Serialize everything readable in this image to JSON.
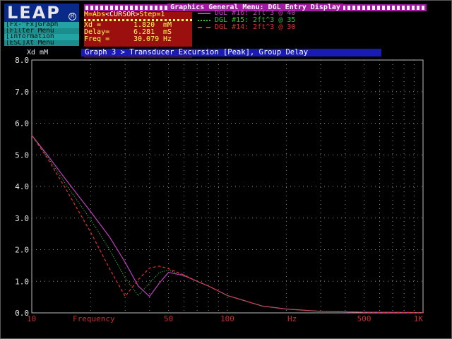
{
  "logo": {
    "text": "LEAP",
    "reg": "R"
  },
  "side_menu": {
    "items": [
      {
        "label": "[Fx-^Fx]Graph"
      },
      {
        "label": "[Filter Menu"
      },
      {
        "label": "[Information"
      },
      {
        "label": "[ESC]Xt Menu"
      }
    ]
  },
  "top_bar": {
    "title": "Graphics General Menu: DGL Entry Display"
  },
  "readout": {
    "mode": "M=Abs",
    "cursor": "<CURSOR>",
    "step": "Step=1",
    "rows": [
      {
        "label": "Xd    =",
        "value": "1.820",
        "unit": "mM"
      },
      {
        "label": "Delay=",
        "value": "6.281",
        "unit": "mS"
      },
      {
        "label": "Freq =",
        "value": "30.079",
        "unit": "Hz"
      }
    ],
    "keys": "[INS][DEL][+][-][=][^]"
  },
  "legend": [
    {
      "style": "solid",
      "color": "#c040c0",
      "label": "DGL #16: 2ft^3 @ 40"
    },
    {
      "style": "dotted",
      "color": "#30c030",
      "label": "DGL #15: 2ft^3 @ 35"
    },
    {
      "style": "dashed",
      "color": "#e03030",
      "label": "DGL #14: 2ft^3 @ 30"
    }
  ],
  "graph": {
    "title": "Graph 3 > Transducer Excursion [Peak], Group Delay",
    "y_axis_title": "Xd mM",
    "x_axis_title": "Frequency",
    "x_unit": "Hz",
    "y_ticks": [
      "8.0",
      "7.0",
      "6.0",
      "5.0",
      "4.0",
      "3.0",
      "2.0",
      "1.0",
      "0.0"
    ],
    "x_ticks": [
      "10",
      "50",
      "100",
      "500",
      "1K"
    ]
  },
  "chart_data": {
    "type": "line",
    "title": "Graph 3 > Transducer Excursion [Peak], Group Delay",
    "xlabel": "Frequency",
    "ylabel": "Xd mM",
    "x_scale": "log",
    "xlim": [
      10,
      1000
    ],
    "ylim": [
      0,
      8
    ],
    "grid": true,
    "legend_position": "top",
    "x_ticks": [
      10,
      50,
      100,
      500,
      1000
    ],
    "y_ticks": [
      0,
      1,
      2,
      3,
      4,
      5,
      6,
      7,
      8
    ],
    "series": [
      {
        "name": "DGL #16: 2ft^3 @ 40",
        "color": "#c040c0",
        "dash": "",
        "x": [
          10,
          12,
          15,
          20,
          25,
          30,
          35,
          40,
          45,
          50,
          60,
          70,
          80,
          100,
          150,
          200,
          300,
          500,
          1000
        ],
        "y": [
          5.62,
          5.0,
          4.2,
          3.2,
          2.4,
          1.6,
          0.85,
          0.52,
          0.95,
          1.28,
          1.18,
          1.0,
          0.85,
          0.55,
          0.22,
          0.12,
          0.05,
          0.02,
          0.01
        ]
      },
      {
        "name": "DGL #15: 2ft^3 @ 35",
        "color": "#30c030",
        "dash": "1 2",
        "x": [
          10,
          12,
          15,
          20,
          25,
          30,
          35,
          40,
          45,
          50,
          60,
          70,
          80,
          100,
          150,
          200,
          300,
          500,
          1000
        ],
        "y": [
          5.62,
          4.95,
          4.05,
          2.95,
          2.0,
          1.1,
          0.55,
          0.95,
          1.28,
          1.35,
          1.2,
          1.0,
          0.85,
          0.55,
          0.22,
          0.12,
          0.05,
          0.02,
          0.01
        ]
      },
      {
        "name": "DGL #14: 2ft^3 @ 30",
        "color": "#e03030",
        "dash": "4 3",
        "x": [
          10,
          12,
          15,
          20,
          25,
          30,
          35,
          40,
          45,
          50,
          60,
          70,
          80,
          100,
          150,
          200,
          300,
          500,
          1000
        ],
        "y": [
          5.62,
          4.9,
          3.9,
          2.55,
          1.4,
          0.52,
          1.05,
          1.42,
          1.48,
          1.4,
          1.2,
          1.0,
          0.85,
          0.55,
          0.22,
          0.12,
          0.05,
          0.02,
          0.01
        ]
      }
    ]
  }
}
